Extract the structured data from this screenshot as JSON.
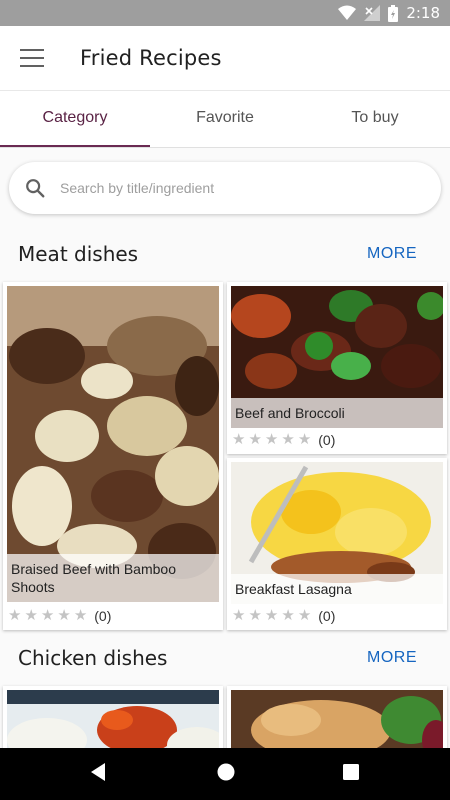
{
  "status_bar": {
    "time": "2:18",
    "icons": [
      "wifi-icon",
      "signal-icon",
      "battery-icon"
    ]
  },
  "app_bar": {
    "title": "Fried Recipes",
    "menu_icon": "menu-icon"
  },
  "tabs": [
    {
      "label": "Category",
      "active": true
    },
    {
      "label": "Favorite",
      "active": false
    },
    {
      "label": "To buy",
      "active": false
    }
  ],
  "search": {
    "placeholder": "Search by title/ingredient",
    "value": ""
  },
  "sections": [
    {
      "title": "Meat dishes",
      "more_label": "MORE",
      "recipes": [
        {
          "title": "Braised Beef with Bamboo Shoots",
          "rating_count": "(0)"
        },
        {
          "title": "Beef and Broccoli",
          "rating_count": "(0)"
        },
        {
          "title": "Breakfast Lasagna",
          "rating_count": "(0)"
        }
      ]
    },
    {
      "title": "Chicken dishes",
      "more_label": "MORE"
    }
  ],
  "colors": {
    "accent": "#6a2a52",
    "link": "#1565c0",
    "status_bar": "#9e9e9e"
  }
}
